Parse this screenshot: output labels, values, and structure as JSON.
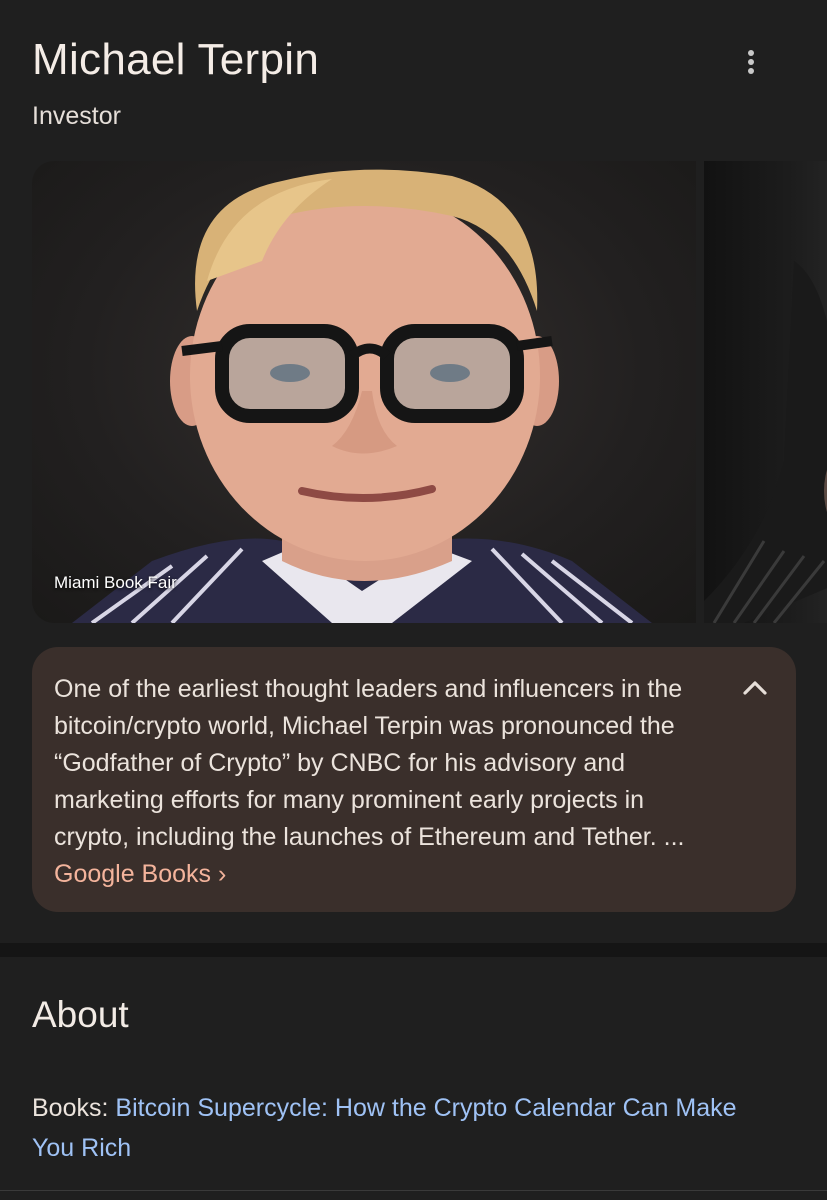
{
  "header": {
    "title": "Michael Terpin",
    "subtitle": "Investor",
    "more_icon": "more-vertical-icon"
  },
  "images": {
    "main_caption": "Miami Book Fair"
  },
  "description": {
    "text": "One of the earliest thought leaders and influencers in the bitcoin/crypto world, Michael Terpin was pronounced the “Godfather of Crypto” by CNBC for his advisory and marketing efforts for many prominent early projects in crypto, including the launches of Ethereum and Tether. ...",
    "source_link": "Google Books",
    "source_chevron": "›",
    "collapse_icon": "chevron-up-icon"
  },
  "about": {
    "heading": "About",
    "books_label": "Books:",
    "books_value": "Bitcoin Supercycle: How the Crypto Calendar Can Make You Rich"
  },
  "colors": {
    "background": "#1f1f1f",
    "card": "#3a2f2b",
    "link_orange": "#f4b49c",
    "link_blue": "#9fc2f5"
  }
}
